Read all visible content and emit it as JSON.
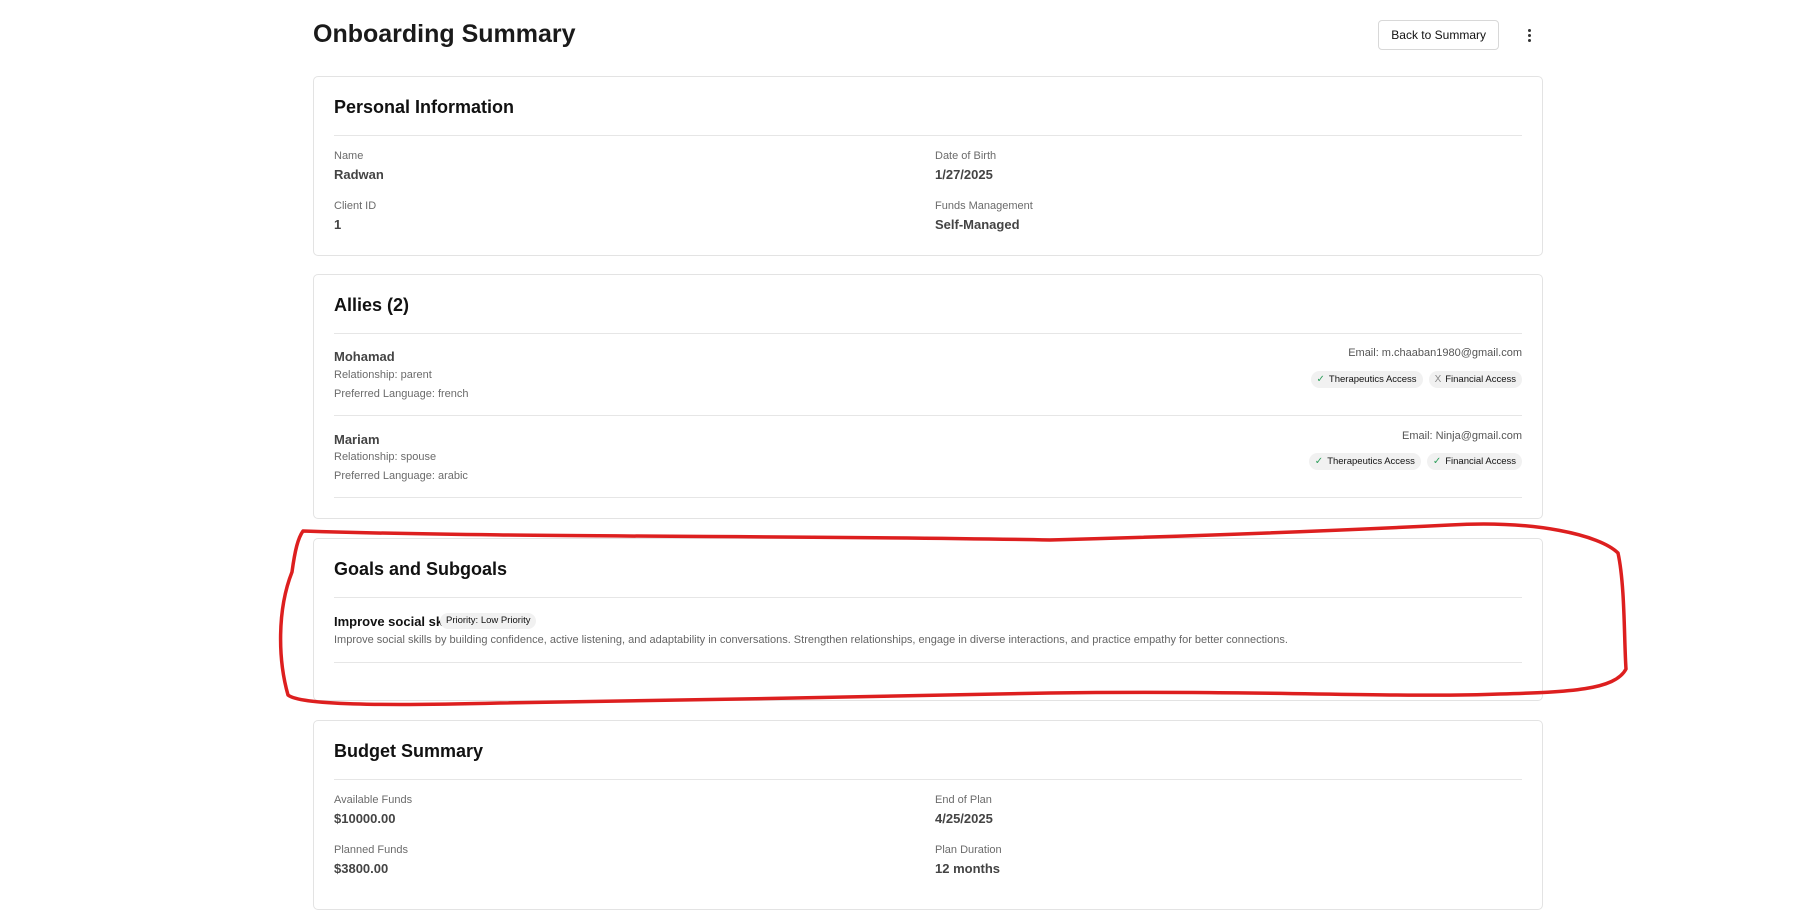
{
  "header": {
    "title": "Onboarding Summary",
    "back_button_label": "Back to Summary",
    "more_icon": "more-vertical-icon"
  },
  "personal_info": {
    "title": "Personal Information",
    "name_label": "Name",
    "name_value": "Radwan",
    "dob_label": "Date of Birth",
    "dob_value": "1/27/2025",
    "client_id_label": "Client ID",
    "client_id_value": "1",
    "funds_mgmt_label": "Funds Management",
    "funds_mgmt_value": "Self-Managed"
  },
  "allies": {
    "title": "Allies (2)",
    "items": [
      {
        "name": "Mohamad",
        "relationship": "Relationship: parent",
        "language": "Preferred Language: french",
        "email": "Email: m.chaaban1980@gmail.com",
        "therapeutics_mark": "✓",
        "therapeutics_label": "Therapeutics Access",
        "financial_mark": "X",
        "financial_label": "Financial Access"
      },
      {
        "name": "Mariam",
        "relationship": "Relationship: spouse",
        "language": "Preferred Language: arabic",
        "email": "Email: Ninja@gmail.com",
        "therapeutics_mark": "✓",
        "therapeutics_label": "Therapeutics Access",
        "financial_mark": "✓",
        "financial_label": "Financial Access"
      }
    ]
  },
  "goals": {
    "title": "Goals and Subgoals",
    "items": [
      {
        "title": "Improve social skills",
        "priority": "Priority: Low Priority",
        "description": "Improve social skills by building confidence, active listening, and adaptability in conversations. Strengthen relationships, engage in diverse interactions, and practice empathy for better connections."
      }
    ]
  },
  "budget": {
    "title": "Budget Summary",
    "available_label": "Available Funds",
    "available_value": "$10000.00",
    "end_label": "End of Plan",
    "end_value": "4/25/2025",
    "planned_label": "Planned Funds",
    "planned_value": "$3800.00",
    "duration_label": "Plan Duration",
    "duration_value": "12 months"
  },
  "colors": {
    "annotation": "#dd1f1f",
    "check_green": "#2e9e5b"
  }
}
